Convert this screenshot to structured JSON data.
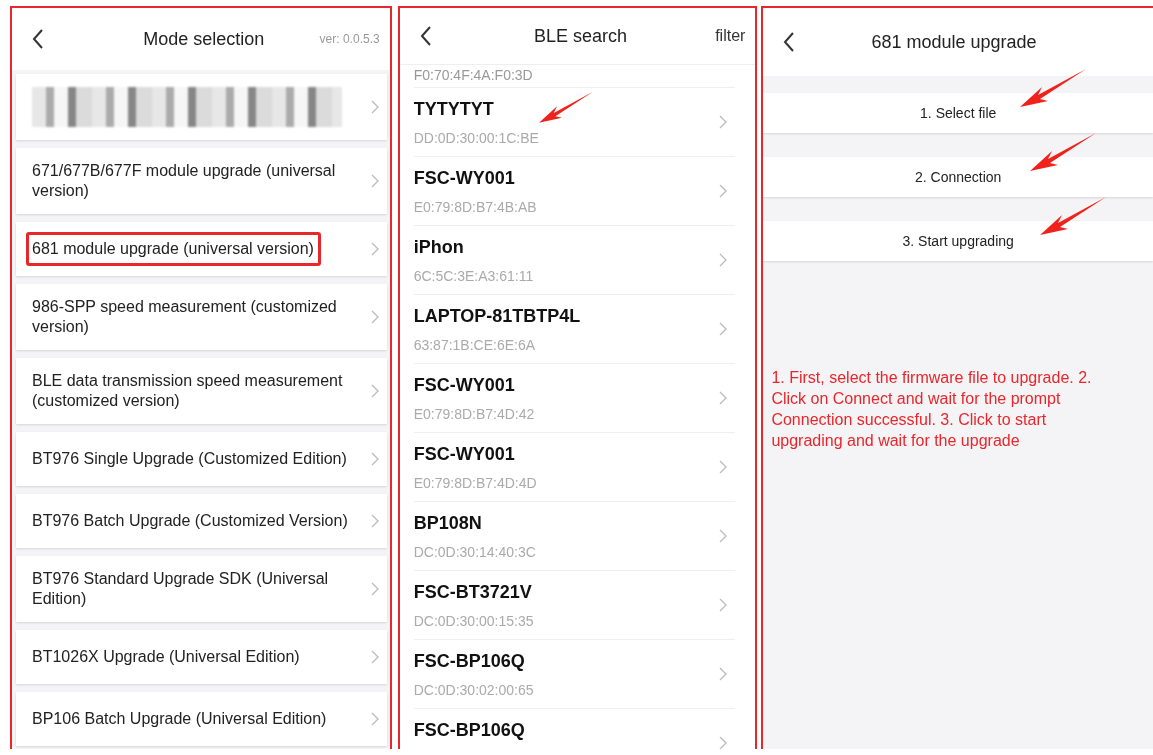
{
  "mode_screen": {
    "title": "Mode selection",
    "version": "ver: 0.0.5.3",
    "items": [
      {
        "kind": "redacted",
        "highlighted": false
      },
      {
        "kind": "text",
        "label": "671/677B/677F module upgrade (universal version)",
        "highlighted": false
      },
      {
        "kind": "text",
        "label": "681 module upgrade (universal version)",
        "highlighted": true
      },
      {
        "kind": "text",
        "label": "986-SPP speed measurement (customized version)",
        "highlighted": false
      },
      {
        "kind": "text",
        "label": "BLE data transmission speed measurement (customized version)",
        "highlighted": false
      },
      {
        "kind": "text",
        "label": "BT976 Single Upgrade (Customized Edition)",
        "highlighted": false
      },
      {
        "kind": "text",
        "label": "BT976 Batch Upgrade (Customized Version)",
        "highlighted": false
      },
      {
        "kind": "text",
        "label": "BT976 Standard Upgrade SDK (Universal Edition)",
        "highlighted": false
      },
      {
        "kind": "text",
        "label": "BT1026X Upgrade (Universal Edition)",
        "highlighted": false
      },
      {
        "kind": "text",
        "label": "BP106 Batch Upgrade (Universal Edition)",
        "highlighted": false
      }
    ]
  },
  "ble_screen": {
    "title": "BLE search",
    "filter": "filter",
    "top_address": "F0:70:4F:4A:F0:3D",
    "devices": [
      {
        "name": "TYTYTYT",
        "address": "DD:0D:30:00:1C:BE",
        "arrow": true
      },
      {
        "name": "FSC-WY001",
        "address": "E0:79:8D:B7:4B:AB",
        "arrow": false
      },
      {
        "name": "iPhon",
        "address": "6C:5C:3E:A3:61:11",
        "arrow": false
      },
      {
        "name": "LAPTOP-81TBTP4L",
        "address": "63:87:1B:CE:6E:6A",
        "arrow": false
      },
      {
        "name": "FSC-WY001",
        "address": "E0:79:8D:B7:4D:42",
        "arrow": false
      },
      {
        "name": "FSC-WY001",
        "address": "E0:79:8D:B7:4D:4D",
        "arrow": false
      },
      {
        "name": "BP108N",
        "address": "DC:0D:30:14:40:3C",
        "arrow": false
      },
      {
        "name": "FSC-BT3721V",
        "address": "DC:0D:30:00:15:35",
        "arrow": false
      },
      {
        "name": "FSC-BP106Q",
        "address": "DC:0D:30:02:00:65",
        "arrow": false
      },
      {
        "name": "FSC-BP106Q",
        "arrow": false
      }
    ]
  },
  "upgrade_screen": {
    "title": "681 module upgrade",
    "buttons": [
      {
        "label": "1. Select file",
        "arrow": true
      },
      {
        "label": "2. Connection",
        "arrow": true
      },
      {
        "label": "3. Start upgrading",
        "arrow": true
      }
    ],
    "instructions": "1. First, select the firmware file to upgrade. 2. Click on Connect and wait for the prompt Connection successful. 3. Click to start upgrading and wait for the upgrade"
  }
}
